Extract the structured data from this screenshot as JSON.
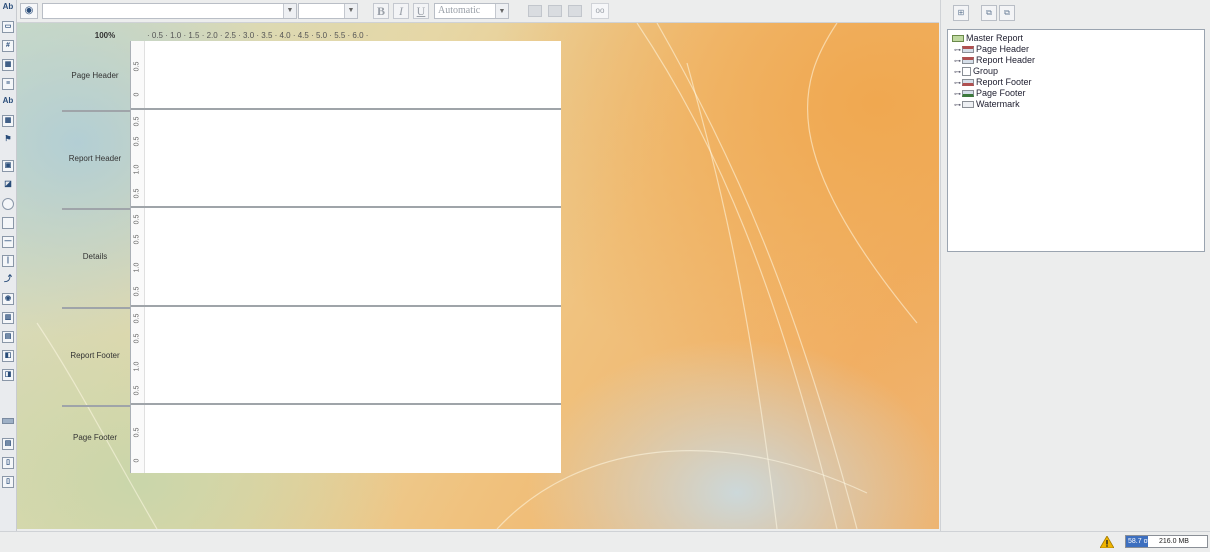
{
  "palette": {
    "icons": [
      "label-icon",
      "text-field-icon",
      "number-field-icon",
      "date-field-icon",
      "message-field-icon",
      "resource-label-icon",
      "resource-field-icon",
      "resource-message-icon",
      "image-field-icon",
      "image-icon",
      "ellipse-icon",
      "rectangle-icon",
      "horizontal-line-icon",
      "vertical-line-icon",
      "survey-scale-icon",
      "chart-icon",
      "barcode-icon",
      "band-icon",
      "subreport-icon",
      "sub-report-2-icon",
      "separator-icon",
      "table-of-contents-icon",
      "index-icon",
      "sub-band-icon"
    ],
    "glyphs": {
      "label": "Ab",
      "resource_label": "Ab"
    }
  },
  "toolbar": {
    "font_name_value": "",
    "font_size_value": "",
    "bold_label": "B",
    "italic_label": "I",
    "underline_label": "U",
    "color_value": "Automatic",
    "link_label": "oo"
  },
  "designer": {
    "zoom": "100%",
    "ruler_marks": "· 0.5 · 1.0 · 1.5 · 2.0 · 2.5 · 3.0 · 3.5 · 4.0 · 4.5 · 5.0 · 5.5 · 6.0 ·",
    "bands": [
      {
        "label": "Page Header",
        "ruler": [
          "0",
          "0.5"
        ]
      },
      {
        "label": "Report Header",
        "ruler": [
          "0.5",
          "0.5",
          "1.0",
          "0.5"
        ]
      },
      {
        "label": "Details",
        "ruler": [
          "0.5",
          "0.5",
          "1.0",
          "0.5"
        ]
      },
      {
        "label": "Report Footer",
        "ruler": [
          "0.5",
          "0.5",
          "1.0",
          "0.5"
        ]
      },
      {
        "label": "Page Footer",
        "ruler": [
          "0",
          "0.5"
        ]
      }
    ]
  },
  "structure_tree": {
    "root": "Master Report",
    "items": [
      "Page Header",
      "Report Header",
      "Group",
      "Report Footer",
      "Page Footer",
      "Watermark"
    ]
  },
  "status": {
    "memory_used": "58.7 of",
    "memory_total": "216.0 MB",
    "memory_fraction": 0.27
  },
  "colors": {
    "accent": "#3d6fbf",
    "warning": "#f0b400"
  }
}
